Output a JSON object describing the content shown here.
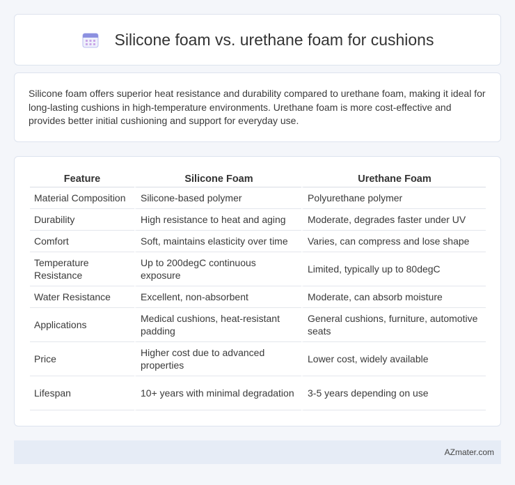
{
  "header": {
    "icon": "calendar-icon",
    "title": "Silicone foam vs. urethane foam for cushions"
  },
  "intro": {
    "text": "Silicone foam offers superior heat resistance and durability compared to urethane foam, making it ideal for long-lasting cushions in high-temperature environments. Urethane foam is more cost-effective and provides better initial cushioning and support for everyday use."
  },
  "table": {
    "headers": [
      "Feature",
      "Silicone Foam",
      "Urethane Foam"
    ],
    "rows": [
      [
        "Material Composition",
        "Silicone-based polymer",
        "Polyurethane polymer"
      ],
      [
        "Durability",
        "High resistance to heat and aging",
        "Moderate, degrades faster under UV"
      ],
      [
        "Comfort",
        "Soft, maintains elasticity over time",
        "Varies, can compress and lose shape"
      ],
      [
        "Temperature Resistance",
        "Up to 200degC continuous exposure",
        "Limited, typically up to 80degC"
      ],
      [
        "Water Resistance",
        "Excellent, non-absorbent",
        "Moderate, can absorb moisture"
      ],
      [
        "Applications",
        "Medical cushions, heat-resistant padding",
        "General cushions, furniture, automotive seats"
      ],
      [
        "Price",
        "Higher cost due to advanced properties",
        "Lower cost, widely available"
      ],
      [
        "Lifespan",
        "10+ years with minimal degradation",
        "3-5 years depending on use"
      ]
    ]
  },
  "footer": {
    "brand": "AZmater.com"
  },
  "colors": {
    "page_background": "#f4f6fa",
    "footer_background": "#e6ecf6",
    "icon_accent": "#7b7fd8"
  }
}
